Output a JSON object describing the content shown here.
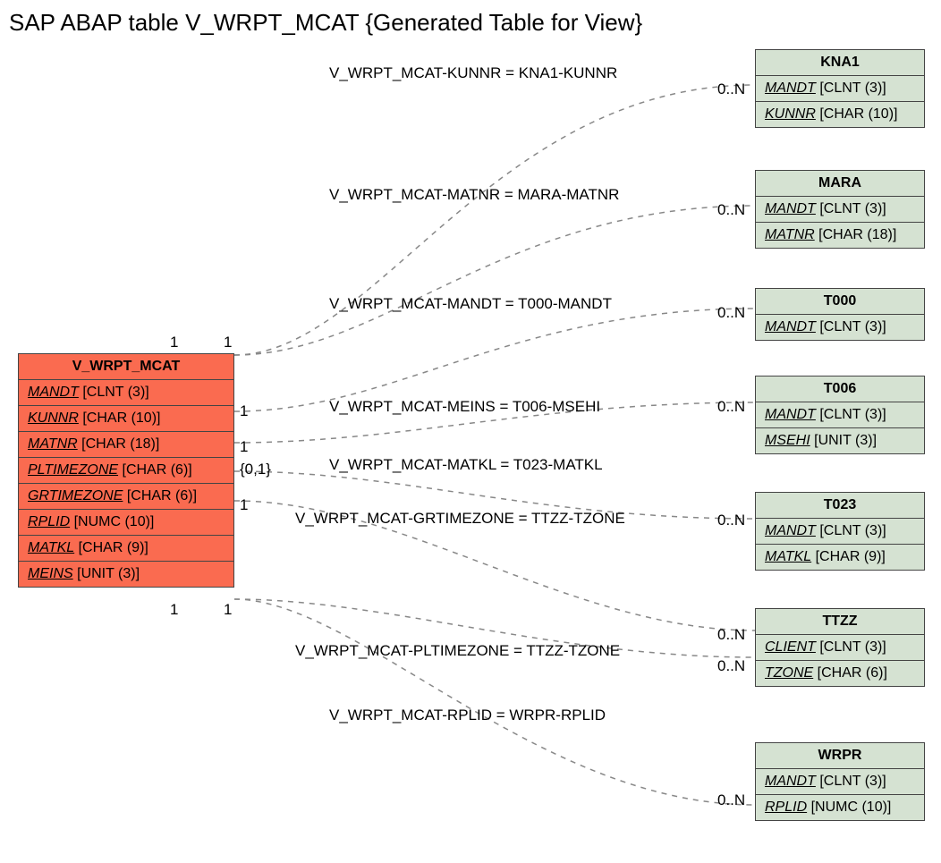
{
  "title": "SAP ABAP table V_WRPT_MCAT {Generated Table for View}",
  "main": {
    "name": "V_WRPT_MCAT",
    "fields": [
      {
        "n": "MANDT",
        "t": "[CLNT (3)]"
      },
      {
        "n": "KUNNR",
        "t": "[CHAR (10)]"
      },
      {
        "n": "MATNR",
        "t": "[CHAR (18)]"
      },
      {
        "n": "PLTIMEZONE",
        "t": "[CHAR (6)]"
      },
      {
        "n": "GRTIMEZONE",
        "t": "[CHAR (6)]"
      },
      {
        "n": "RPLID",
        "t": "[NUMC (10)]"
      },
      {
        "n": "MATKL",
        "t": "[CHAR (9)]"
      },
      {
        "n": "MEINS",
        "t": "[UNIT (3)]"
      }
    ]
  },
  "targets": [
    {
      "name": "KNA1",
      "fields": [
        {
          "n": "MANDT",
          "t": "[CLNT (3)]"
        },
        {
          "n": "KUNNR",
          "t": "[CHAR (10)]"
        }
      ]
    },
    {
      "name": "MARA",
      "fields": [
        {
          "n": "MANDT",
          "t": "[CLNT (3)]"
        },
        {
          "n": "MATNR",
          "t": "[CHAR (18)]"
        }
      ]
    },
    {
      "name": "T000",
      "fields": [
        {
          "n": "MANDT",
          "t": "[CLNT (3)]"
        }
      ]
    },
    {
      "name": "T006",
      "fields": [
        {
          "n": "MANDT",
          "t": "[CLNT (3)]"
        },
        {
          "n": "MSEHI",
          "t": "[UNIT (3)]"
        }
      ]
    },
    {
      "name": "T023",
      "fields": [
        {
          "n": "MANDT",
          "t": "[CLNT (3)]"
        },
        {
          "n": "MATKL",
          "t": "[CHAR (9)]"
        }
      ]
    },
    {
      "name": "TTZZ",
      "fields": [
        {
          "n": "CLIENT",
          "t": "[CLNT (3)]"
        },
        {
          "n": "TZONE",
          "t": "[CHAR (6)]"
        }
      ]
    },
    {
      "name": "WRPR",
      "fields": [
        {
          "n": "MANDT",
          "t": "[CLNT (3)]"
        },
        {
          "n": "RPLID",
          "t": "[NUMC (10)]"
        }
      ]
    }
  ],
  "relations": [
    {
      "label": "V_WRPT_MCAT-KUNNR = KNA1-KUNNR"
    },
    {
      "label": "V_WRPT_MCAT-MATNR = MARA-MATNR"
    },
    {
      "label": "V_WRPT_MCAT-MANDT = T000-MANDT"
    },
    {
      "label": "V_WRPT_MCAT-MEINS = T006-MSEHI"
    },
    {
      "label": "V_WRPT_MCAT-MATKL = T023-MATKL"
    },
    {
      "label": "V_WRPT_MCAT-GRTIMEZONE = TTZZ-TZONE"
    },
    {
      "label": "V_WRPT_MCAT-PLTIMEZONE = TTZZ-TZONE"
    },
    {
      "label": "V_WRPT_MCAT-RPLID = WRPR-RPLID"
    }
  ],
  "card": {
    "c1_top": "1",
    "c1_bot": "1",
    "c2_top": "1",
    "c2_1": "1",
    "c2_2": "1",
    "c2_3": "{0,1}",
    "c2_4": "1",
    "c3_bot1": "1",
    "c3_bot2": "1",
    "r_0N": "0..N"
  }
}
